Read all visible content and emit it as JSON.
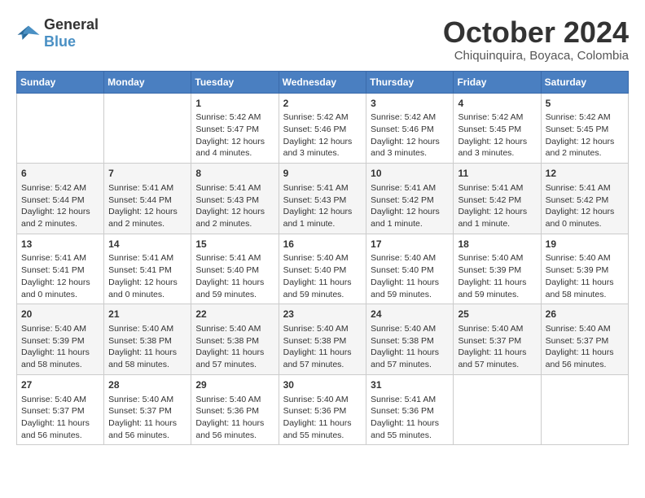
{
  "header": {
    "logo_line1": "General",
    "logo_line2": "Blue",
    "month": "October 2024",
    "location": "Chiquinquira, Boyaca, Colombia"
  },
  "days_of_week": [
    "Sunday",
    "Monday",
    "Tuesday",
    "Wednesday",
    "Thursday",
    "Friday",
    "Saturday"
  ],
  "weeks": [
    [
      {
        "day": "",
        "empty": true
      },
      {
        "day": "",
        "empty": true
      },
      {
        "day": "1",
        "sunrise": "Sunrise: 5:42 AM",
        "sunset": "Sunset: 5:47 PM",
        "daylight": "Daylight: 12 hours and 4 minutes."
      },
      {
        "day": "2",
        "sunrise": "Sunrise: 5:42 AM",
        "sunset": "Sunset: 5:46 PM",
        "daylight": "Daylight: 12 hours and 3 minutes."
      },
      {
        "day": "3",
        "sunrise": "Sunrise: 5:42 AM",
        "sunset": "Sunset: 5:46 PM",
        "daylight": "Daylight: 12 hours and 3 minutes."
      },
      {
        "day": "4",
        "sunrise": "Sunrise: 5:42 AM",
        "sunset": "Sunset: 5:45 PM",
        "daylight": "Daylight: 12 hours and 3 minutes."
      },
      {
        "day": "5",
        "sunrise": "Sunrise: 5:42 AM",
        "sunset": "Sunset: 5:45 PM",
        "daylight": "Daylight: 12 hours and 2 minutes."
      }
    ],
    [
      {
        "day": "6",
        "sunrise": "Sunrise: 5:42 AM",
        "sunset": "Sunset: 5:44 PM",
        "daylight": "Daylight: 12 hours and 2 minutes."
      },
      {
        "day": "7",
        "sunrise": "Sunrise: 5:41 AM",
        "sunset": "Sunset: 5:44 PM",
        "daylight": "Daylight: 12 hours and 2 minutes."
      },
      {
        "day": "8",
        "sunrise": "Sunrise: 5:41 AM",
        "sunset": "Sunset: 5:43 PM",
        "daylight": "Daylight: 12 hours and 2 minutes."
      },
      {
        "day": "9",
        "sunrise": "Sunrise: 5:41 AM",
        "sunset": "Sunset: 5:43 PM",
        "daylight": "Daylight: 12 hours and 1 minute."
      },
      {
        "day": "10",
        "sunrise": "Sunrise: 5:41 AM",
        "sunset": "Sunset: 5:42 PM",
        "daylight": "Daylight: 12 hours and 1 minute."
      },
      {
        "day": "11",
        "sunrise": "Sunrise: 5:41 AM",
        "sunset": "Sunset: 5:42 PM",
        "daylight": "Daylight: 12 hours and 1 minute."
      },
      {
        "day": "12",
        "sunrise": "Sunrise: 5:41 AM",
        "sunset": "Sunset: 5:42 PM",
        "daylight": "Daylight: 12 hours and 0 minutes."
      }
    ],
    [
      {
        "day": "13",
        "sunrise": "Sunrise: 5:41 AM",
        "sunset": "Sunset: 5:41 PM",
        "daylight": "Daylight: 12 hours and 0 minutes."
      },
      {
        "day": "14",
        "sunrise": "Sunrise: 5:41 AM",
        "sunset": "Sunset: 5:41 PM",
        "daylight": "Daylight: 12 hours and 0 minutes."
      },
      {
        "day": "15",
        "sunrise": "Sunrise: 5:41 AM",
        "sunset": "Sunset: 5:40 PM",
        "daylight": "Daylight: 11 hours and 59 minutes."
      },
      {
        "day": "16",
        "sunrise": "Sunrise: 5:40 AM",
        "sunset": "Sunset: 5:40 PM",
        "daylight": "Daylight: 11 hours and 59 minutes."
      },
      {
        "day": "17",
        "sunrise": "Sunrise: 5:40 AM",
        "sunset": "Sunset: 5:40 PM",
        "daylight": "Daylight: 11 hours and 59 minutes."
      },
      {
        "day": "18",
        "sunrise": "Sunrise: 5:40 AM",
        "sunset": "Sunset: 5:39 PM",
        "daylight": "Daylight: 11 hours and 59 minutes."
      },
      {
        "day": "19",
        "sunrise": "Sunrise: 5:40 AM",
        "sunset": "Sunset: 5:39 PM",
        "daylight": "Daylight: 11 hours and 58 minutes."
      }
    ],
    [
      {
        "day": "20",
        "sunrise": "Sunrise: 5:40 AM",
        "sunset": "Sunset: 5:39 PM",
        "daylight": "Daylight: 11 hours and 58 minutes."
      },
      {
        "day": "21",
        "sunrise": "Sunrise: 5:40 AM",
        "sunset": "Sunset: 5:38 PM",
        "daylight": "Daylight: 11 hours and 58 minutes."
      },
      {
        "day": "22",
        "sunrise": "Sunrise: 5:40 AM",
        "sunset": "Sunset: 5:38 PM",
        "daylight": "Daylight: 11 hours and 57 minutes."
      },
      {
        "day": "23",
        "sunrise": "Sunrise: 5:40 AM",
        "sunset": "Sunset: 5:38 PM",
        "daylight": "Daylight: 11 hours and 57 minutes."
      },
      {
        "day": "24",
        "sunrise": "Sunrise: 5:40 AM",
        "sunset": "Sunset: 5:38 PM",
        "daylight": "Daylight: 11 hours and 57 minutes."
      },
      {
        "day": "25",
        "sunrise": "Sunrise: 5:40 AM",
        "sunset": "Sunset: 5:37 PM",
        "daylight": "Daylight: 11 hours and 57 minutes."
      },
      {
        "day": "26",
        "sunrise": "Sunrise: 5:40 AM",
        "sunset": "Sunset: 5:37 PM",
        "daylight": "Daylight: 11 hours and 56 minutes."
      }
    ],
    [
      {
        "day": "27",
        "sunrise": "Sunrise: 5:40 AM",
        "sunset": "Sunset: 5:37 PM",
        "daylight": "Daylight: 11 hours and 56 minutes."
      },
      {
        "day": "28",
        "sunrise": "Sunrise: 5:40 AM",
        "sunset": "Sunset: 5:37 PM",
        "daylight": "Daylight: 11 hours and 56 minutes."
      },
      {
        "day": "29",
        "sunrise": "Sunrise: 5:40 AM",
        "sunset": "Sunset: 5:36 PM",
        "daylight": "Daylight: 11 hours and 56 minutes."
      },
      {
        "day": "30",
        "sunrise": "Sunrise: 5:40 AM",
        "sunset": "Sunset: 5:36 PM",
        "daylight": "Daylight: 11 hours and 55 minutes."
      },
      {
        "day": "31",
        "sunrise": "Sunrise: 5:41 AM",
        "sunset": "Sunset: 5:36 PM",
        "daylight": "Daylight: 11 hours and 55 minutes."
      },
      {
        "day": "",
        "empty": true
      },
      {
        "day": "",
        "empty": true
      }
    ]
  ]
}
